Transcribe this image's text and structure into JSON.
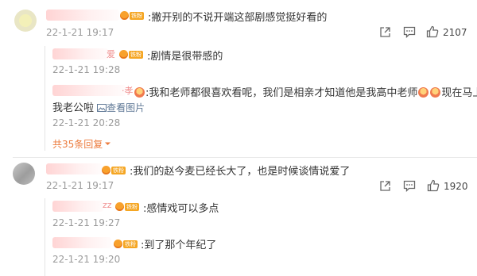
{
  "comments": [
    {
      "text": ":撇开别的不说开端这部剧感觉挺好看的",
      "time": "22-1-21 19:17",
      "likes": "2107",
      "badge": "铁粉",
      "replies": [
        {
          "name_tail": "爱",
          "badge": "铁粉",
          "text": ":剧情是很带感的",
          "time": "22-1-21 19:28"
        },
        {
          "name_tail": "·孝",
          "text_a": ":我和老师都很喜欢看呢，我们是相亲才知道他是我高中老师",
          "text_b": "现在马上是",
          "text_c": "我老公啦",
          "pic_label": "查看图片",
          "time": "22-1-21 20:28"
        }
      ],
      "more_replies": "共35条回复"
    },
    {
      "text": ":我们的赵今麦已经长大了，也是时候谈情说爱了",
      "time": "22-1-21 19:17",
      "likes": "1920",
      "badge": "铁粉",
      "replies": [
        {
          "name_tail": "zz",
          "badge": "铁粉",
          "text": ":感情戏可以多点",
          "time": "22-1-21 19:27"
        },
        {
          "name_tail": "",
          "badge": "铁粉",
          "text": ":到了那个年纪了",
          "time": "22-1-21 19:20"
        }
      ]
    }
  ],
  "icons": {
    "share": "share-icon",
    "comment": "comment-icon",
    "like": "thumb-up-icon",
    "fan_badge": "fan-badge-icon",
    "picture": "picture-icon",
    "chevron": "chevron-down-icon"
  },
  "colors": {
    "more": "#ec7b3d",
    "pic_link": "#5f7896",
    "badge": "#f5a623"
  }
}
